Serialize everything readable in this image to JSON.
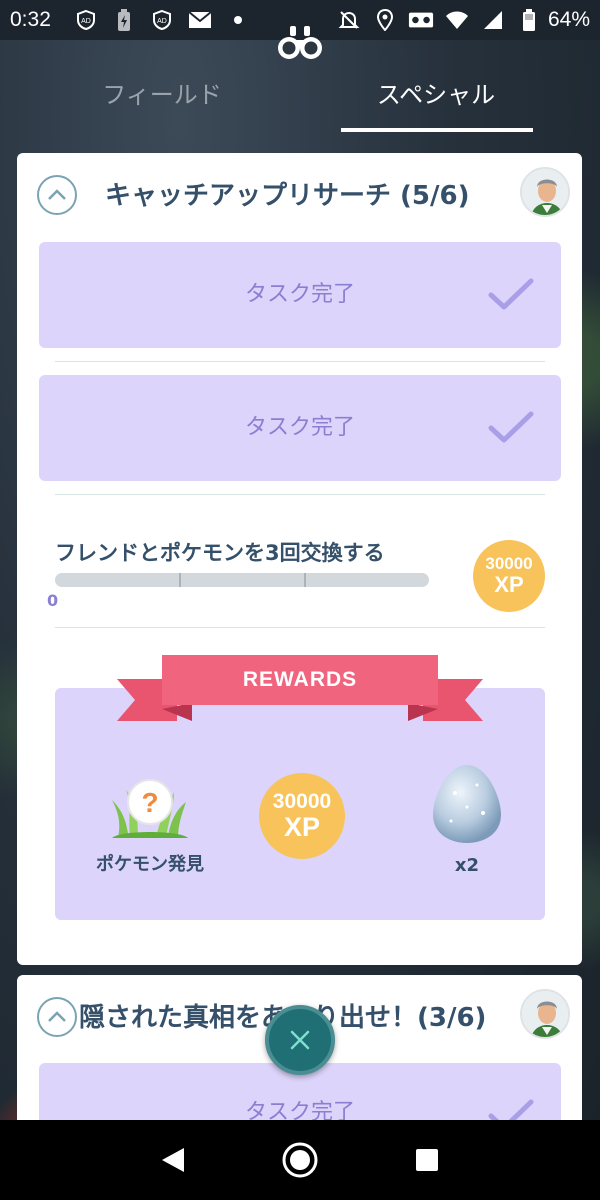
{
  "status_bar": {
    "time": "0:32",
    "battery": "64%",
    "left_icons": [
      "ad-block-icon",
      "battery-saver-icon",
      "ad-block-icon",
      "mail-icon",
      "dot-icon"
    ],
    "right_icons": [
      "notifications-off-icon",
      "location-icon",
      "vr-icon",
      "wifi-icon",
      "signal-icon",
      "battery-icon"
    ]
  },
  "tabs": {
    "field": "フィールド",
    "special": "スペシャル",
    "active": "special"
  },
  "research_card": {
    "title": "キャッチアップリサーチ (5/6)",
    "completed_tasks": [
      {
        "label": "タスク完了"
      },
      {
        "label": "タスク完了"
      }
    ],
    "active_task": {
      "text": "フレンドとポケモンを3回交換する",
      "progress_value": "0",
      "progress_fraction": 0,
      "progress_steps": 3,
      "reward_xp": {
        "amount": "30000",
        "unit": "XP"
      }
    },
    "rewards": {
      "label": "REWARDS",
      "items": [
        {
          "icon": "pokemon-encounter-icon",
          "caption": "ポケモン発見"
        },
        {
          "icon": "xp-icon",
          "amount": "30000",
          "unit": "XP"
        },
        {
          "icon": "egg-icon",
          "caption": "x2"
        }
      ]
    }
  },
  "second_card": {
    "title": "隠された真相をあぶり出せ！(3/6)",
    "task_label": "タスク完了"
  },
  "colors": {
    "accent_purple": "#ddd4fb",
    "title_text": "#35506a",
    "xp_gold": "#f7c35a",
    "ribbon_pink": "#f0647e",
    "fab_teal": "#1f6f74"
  }
}
